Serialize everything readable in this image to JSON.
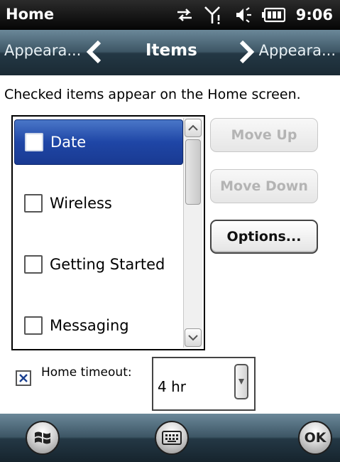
{
  "status_bar": {
    "title": "Home",
    "time": "9:06",
    "icons": [
      "data-sync-icon",
      "signal-icon",
      "speaker-icon",
      "battery-icon"
    ]
  },
  "tab_bar": {
    "previous": "Appeara...",
    "current": "Items",
    "next": "Appeara..."
  },
  "instruction": "Checked items appear on the Home screen.",
  "items_list": {
    "items": [
      {
        "label": "Date",
        "checked": false,
        "selected": true
      },
      {
        "label": "Wireless",
        "checked": false,
        "selected": false
      },
      {
        "label": "Getting Started",
        "checked": false,
        "selected": false
      },
      {
        "label": "Messaging",
        "checked": false,
        "selected": false
      }
    ]
  },
  "buttons": {
    "move_up": "Move Up",
    "move_down": "Move Down",
    "options": "Options..."
  },
  "timeout": {
    "label": "Home timeout:",
    "checked": true,
    "value": "4 hr"
  },
  "softkeys": {
    "ok": "OK"
  },
  "colors": {
    "selection": "#1f46a6",
    "bar_top": "#6b8899",
    "bar_bottom": "#1a2a34",
    "status_bar": "#050505"
  }
}
